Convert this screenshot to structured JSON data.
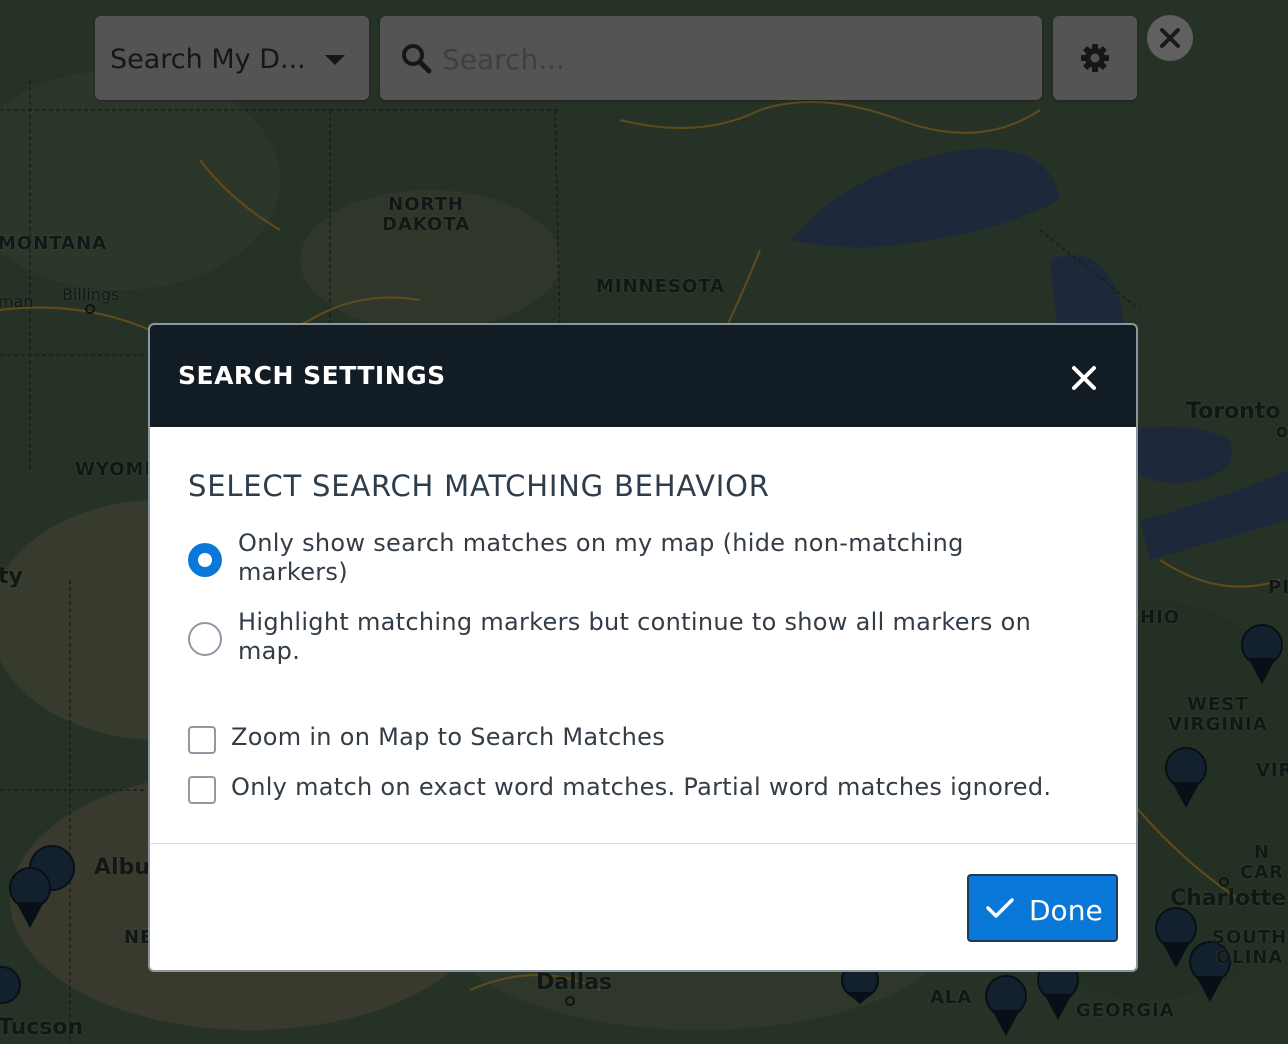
{
  "toolbar": {
    "dataset_label": "Search My D...",
    "search_placeholder": "Search..."
  },
  "map_labels": {
    "states": [
      "NORTH DAKOTA",
      "MONTANA",
      "MINNESOTA",
      "WYOMI",
      "WEST VIRGINIA",
      "HIO",
      "NORTH CAROLINA",
      "SOUTH CAROLINA",
      "GEORGIA",
      "ALA",
      "NE",
      "PI",
      "VIR"
    ],
    "cities": [
      "Billings",
      "Toronto",
      "Charlotte",
      "Albu",
      "Dallas",
      "Tucson",
      "man",
      "ty"
    ]
  },
  "modal": {
    "title": "SEARCH SETTINGS",
    "section_heading": "SELECT SEARCH MATCHING BEHAVIOR",
    "options": [
      {
        "label": "Only show search matches on my map (hide non-matching markers)",
        "selected": true
      },
      {
        "label": "Highlight matching markers but continue to show all markers on map.",
        "selected": false
      }
    ],
    "checkboxes": [
      {
        "label": "Zoom in on Map to Search Matches",
        "checked": false
      },
      {
        "label": "Only match on exact word matches. Partial word matches ignored.",
        "checked": false
      }
    ],
    "done_label": "Done"
  },
  "colors": {
    "header_bg": "#121c25",
    "accent_blue": "#0a78d8",
    "heading_text": "#2e3d4b"
  }
}
